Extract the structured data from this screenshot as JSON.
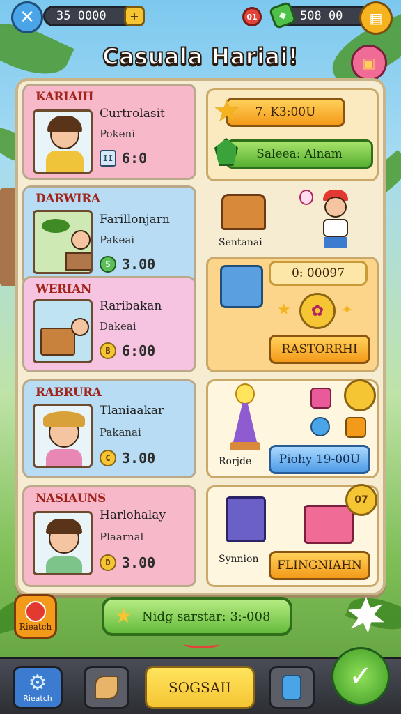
{
  "topbar": {
    "close_icon": "close-icon",
    "currency_left": "35  0000",
    "currency_right": "508   00",
    "alert_badge": "01"
  },
  "title": "Casuala Hariai!",
  "cards": [
    {
      "heading": "KARIAIH",
      "name": "Curtrolasit",
      "sub": "Pokeni",
      "price": "6:0",
      "coin": "II",
      "bg": "#f7b8c9"
    },
    {
      "heading": "DARWIRA",
      "name": "Farillonjarn",
      "sub": "Pakeai",
      "price": "3.00",
      "coin": "S",
      "bg": "#b7dcf3"
    },
    {
      "heading": "WERIAN",
      "name": "Raribakan",
      "sub": "Dakeai",
      "price": "6:00",
      "coin": "B",
      "bg": "#f6c4e0"
    },
    {
      "heading": "RABRURA",
      "name": "Tlaniaakar",
      "sub": "Pakanai",
      "price": "3.00",
      "coin": "C",
      "bg": "#b7dcf3"
    },
    {
      "heading": "NASIAUNS",
      "name": "Harlohalay",
      "sub": "Plaarnal",
      "price": "3.00",
      "coin": "D",
      "bg": "#f7b8c9"
    }
  ],
  "right": {
    "timer_button": "7.  K3:00U",
    "sales_button": "Saleea: Alnam",
    "chest_label": "Sentanai",
    "counter_text": "0:  00097",
    "restore_button": "RASTORRHI",
    "lamp_label": "Rorjde",
    "blue_button": "Piohy 19-00U",
    "gift_label": "Synnion",
    "finish_button": "FLINGNIAHN",
    "coin_badge": "07"
  },
  "side_button_label": "Rieatch",
  "progress_text": "Nidg sarstar: 3:-008",
  "bottom": {
    "settings_label": "Rieatch",
    "center_label": "SOGSAII"
  }
}
